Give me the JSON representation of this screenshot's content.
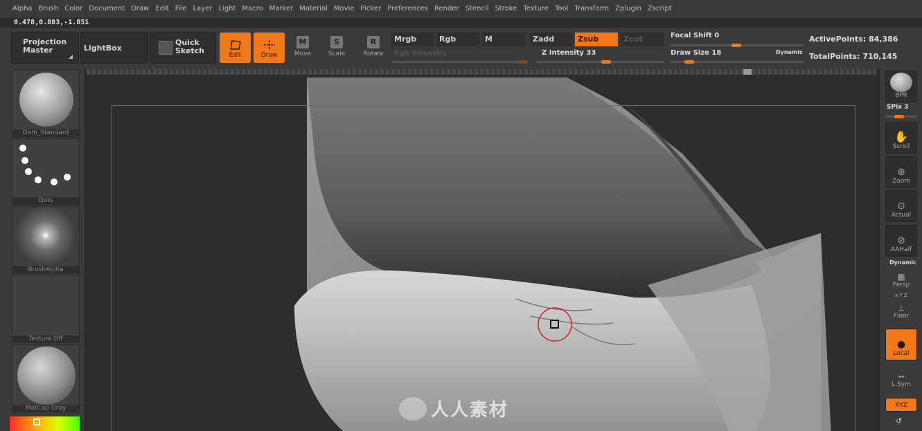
{
  "menu": [
    "Alpha",
    "Brush",
    "Color",
    "Document",
    "Draw",
    "Edit",
    "File",
    "Layer",
    "Light",
    "Macro",
    "Marker",
    "Material",
    "Movie",
    "Picker",
    "Preferences",
    "Render",
    "Stencil",
    "Stroke",
    "Texture",
    "Tool",
    "Transform",
    "Zplugin",
    "Zscript"
  ],
  "coords": "0.478,0.883,-1.851",
  "toolbar": {
    "projection_master": "Projection Master",
    "lightbox": "LightBox",
    "quick_sketch": "Quick Sketch",
    "edit": "Edit",
    "draw": "Draw",
    "move": "Move",
    "scale": "Scale",
    "rotate": "Rotate",
    "move_glyph": "M",
    "scale_glyph": "S",
    "rotate_glyph": "R"
  },
  "modes": {
    "mrgb": "Mrgb",
    "rgb": "Rgb",
    "m": "M",
    "zadd": "Zadd",
    "zsub": "Zsub",
    "zcut": "Zcut",
    "rgb_intensity": "Rgb Intensity",
    "z_intensity_label": "Z Intensity",
    "z_intensity_value": "33",
    "focal_shift_label": "Focal Shift",
    "focal_shift_value": "0",
    "draw_size_label": "Draw Size",
    "draw_size_value": "18",
    "dynamic": "Dynamic"
  },
  "stats": {
    "active_points_label": "ActivePoints:",
    "active_points": "84,386",
    "total_points_label": "TotalPoints:",
    "total_points": "710,145"
  },
  "left_shelf": {
    "brush": "Dam_Standard",
    "stroke": "Dots",
    "alpha": "BrushAlpha",
    "texture": "Texture Off",
    "material": "MatCap Gray"
  },
  "right_shelf": {
    "bpr": "BPR",
    "spix_label": "SPix",
    "spix_value": "3",
    "scroll": "Scroll",
    "zoom": "Zoom",
    "actual": "Actual",
    "aahalf": "AAHalf",
    "dynamic": "Dynamic",
    "persp": "Persp",
    "xyz_small": "x Y Z",
    "floor": "Floor",
    "local": "Local",
    "lsym": "L.Sym",
    "xyz": "XYZ"
  },
  "watermark": "人人素材",
  "colors": {
    "accent": "#f07818",
    "panel": "#3a3a3a",
    "canvas": "#2d2d2d"
  }
}
